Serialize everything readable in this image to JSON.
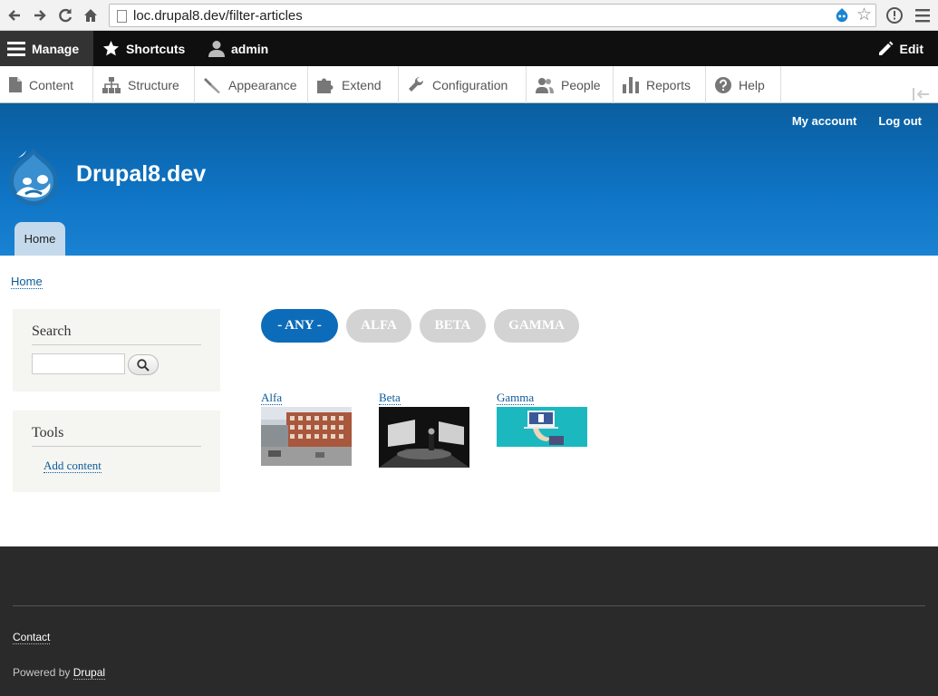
{
  "browser": {
    "url": "loc.drupal8.dev/filter-articles"
  },
  "toolbar": {
    "manage": "Manage",
    "shortcuts": "Shortcuts",
    "user": "admin",
    "edit": "Edit"
  },
  "tray": {
    "items": [
      "Content",
      "Structure",
      "Appearance",
      "Extend",
      "Configuration",
      "People",
      "Reports",
      "Help"
    ]
  },
  "header": {
    "my_account": "My account",
    "logout": "Log out",
    "site_name": "Drupal8.dev",
    "primary_tab": "Home"
  },
  "breadcrumb": "Home",
  "sidebar": {
    "search_title": "Search",
    "tools_title": "Tools",
    "add_content": "Add content"
  },
  "filters": [
    "- ANY -",
    "ALFA",
    "BETA",
    "GAMMA"
  ],
  "active_filter": "- ANY -",
  "articles": [
    {
      "title": "Alfa"
    },
    {
      "title": "Beta"
    },
    {
      "title": "Gamma"
    }
  ],
  "footer": {
    "contact": "Contact",
    "powered_prefix": "Powered by",
    "powered_link": "Drupal"
  },
  "colors": {
    "header_blue": "#0f74c5",
    "active_filter": "#0d6cba",
    "inactive_filter": "#d3d3d3",
    "link": "#0b5b99",
    "footer_bg": "#2a2a2a"
  }
}
